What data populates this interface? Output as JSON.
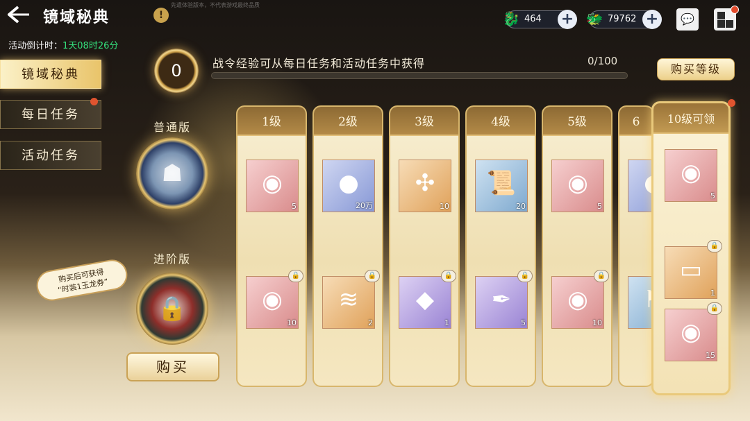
{
  "header": {
    "title": "镜域秘典",
    "notice": "先遣体验版本，不代表游戏最终品质",
    "currencies": [
      {
        "icon": "jade-dragon-icon",
        "value": "464"
      },
      {
        "icon": "gold-dragon-icon",
        "value": "79762"
      }
    ]
  },
  "countdown": {
    "label": "活动倒计时：",
    "value": "1天08时26分"
  },
  "nav": [
    {
      "label": "镜域秘典",
      "active": true,
      "badge": false
    },
    {
      "label": "每日任务",
      "active": false,
      "badge": true
    },
    {
      "label": "活动任务",
      "active": false,
      "badge": false
    }
  ],
  "pass": {
    "level": "0",
    "exp_text": "战令经验可从每日任务和活动任务中获得",
    "exp_value": "0/100",
    "progress": 0.0,
    "buy_level_label": "购买等级"
  },
  "tiers": {
    "normal_label": "普通版",
    "advanced_label": "进阶版",
    "bubble_line1": "购买后可获得",
    "bubble_line2": "“时装1玉龙券”",
    "buy_label": "购买"
  },
  "levels": [
    {
      "label": "1级",
      "free": {
        "color": "pink",
        "icon": "mirror-icon",
        "qty": "5"
      },
      "paid": {
        "color": "pink",
        "icon": "mirror-icon",
        "qty": "10"
      }
    },
    {
      "label": "2级",
      "free": {
        "color": "blue",
        "icon": "coin-icon",
        "qty": "20万"
      },
      "paid": {
        "color": "orange",
        "icon": "scroll-ticket-icon",
        "qty": "2"
      }
    },
    {
      "label": "3级",
      "free": {
        "color": "orange",
        "icon": "puzzle-icon",
        "qty": "10"
      },
      "paid": {
        "color": "purple",
        "icon": "crystal-icon",
        "qty": "1"
      }
    },
    {
      "label": "4级",
      "free": {
        "color": "teal",
        "icon": "scroll-icon",
        "qty": "20"
      },
      "paid": {
        "color": "purple",
        "icon": "brush-icon",
        "qty": "5"
      }
    },
    {
      "label": "5级",
      "free": {
        "color": "pink",
        "icon": "mirror-icon",
        "qty": "5"
      },
      "paid": {
        "color": "pink",
        "icon": "mirror-icon",
        "qty": "10"
      }
    },
    {
      "label": "6",
      "free": {
        "color": "blue",
        "icon": "coin-icon",
        "qty": ""
      },
      "paid": {
        "color": "teal",
        "icon": "banner-icon",
        "qty": ""
      }
    }
  ],
  "reward": {
    "label": "10级可领",
    "items": [
      {
        "color": "pink",
        "icon": "mirror-icon",
        "qty": "5",
        "locked": false
      },
      {
        "color": "orange",
        "icon": "frame-icon",
        "qty": "1",
        "locked": true
      },
      {
        "color": "pink",
        "icon": "mirror-icon",
        "qty": "15",
        "locked": true
      }
    ]
  }
}
